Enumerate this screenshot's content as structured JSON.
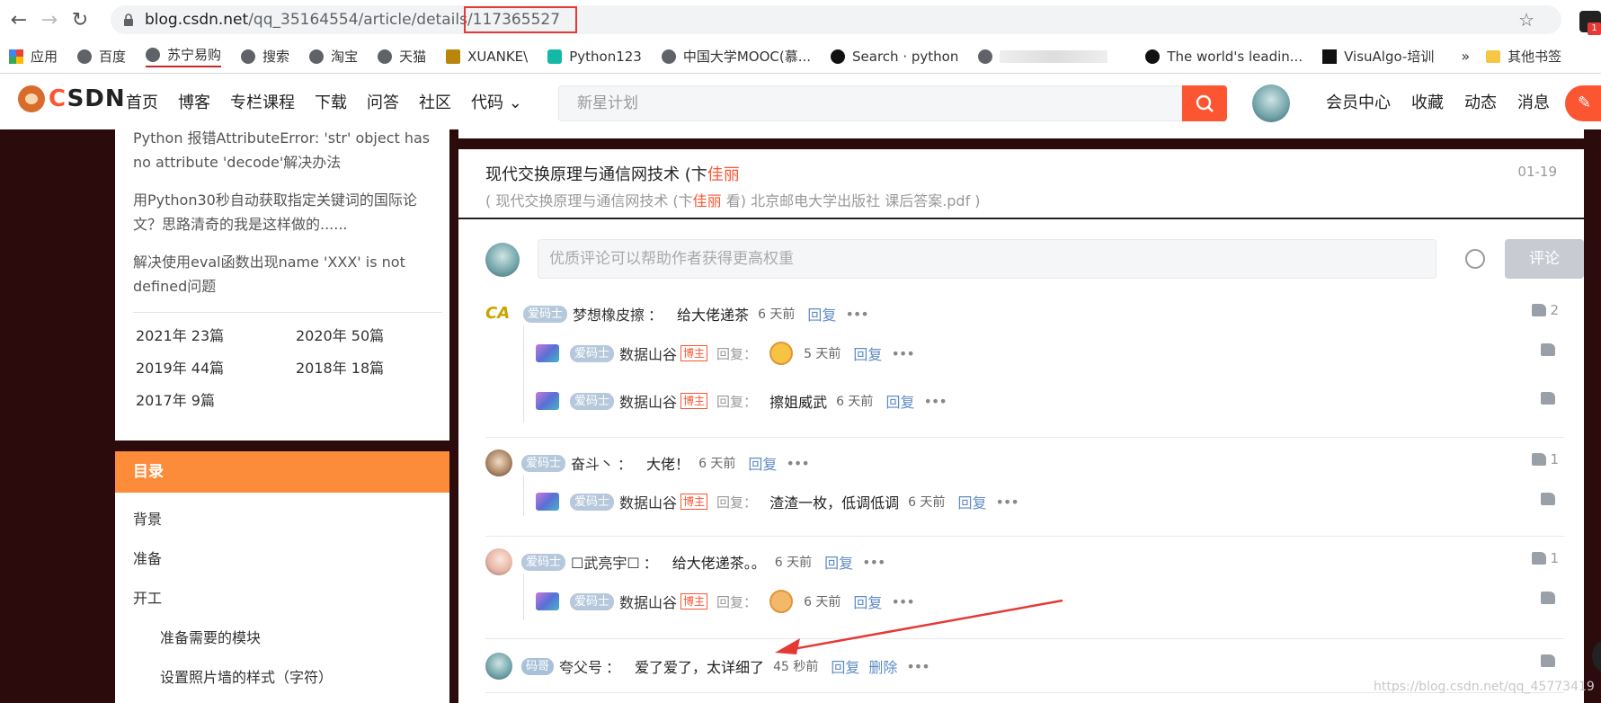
{
  "browser": {
    "url_host": "blog.csdn.net",
    "url_path": "/qq_35164554/article/details/",
    "url_id": "117365527",
    "ext_badge": "1",
    "bookmarks": [
      {
        "label": "应用",
        "icon": "grid"
      },
      {
        "label": "百度",
        "icon": "globe"
      },
      {
        "label": "苏宁易购",
        "icon": "globe",
        "active": true
      },
      {
        "label": "搜索",
        "icon": "globe"
      },
      {
        "label": "淘宝",
        "icon": "globe"
      },
      {
        "label": "天猫",
        "icon": "globe"
      },
      {
        "label": "XUANKE\\",
        "icon": "favicon"
      },
      {
        "label": "Python123",
        "icon": "py"
      },
      {
        "label": "中国大学MOOC(慕...",
        "icon": "globe"
      },
      {
        "label": "Search · python",
        "icon": "github"
      },
      {
        "label": "The world's leadin...",
        "icon": "github"
      },
      {
        "label": "VisuAlgo-培训",
        "icon": "va"
      }
    ],
    "bookmarks_more": "»",
    "other_bookmarks": "其他书签"
  },
  "csdn": {
    "logo": "CSDN",
    "nav": [
      "首页",
      "博客",
      "专栏课程",
      "下载",
      "问答",
      "社区",
      "代码 ⌄"
    ],
    "search_placeholder": "新星计划",
    "right_nav": [
      "会员中心",
      "收藏",
      "动态",
      "消息"
    ]
  },
  "sidebar": {
    "related": [
      "Python 报错AttributeError: 'str' object has no attribute 'decode'解决办法",
      "用Python30秒自动获取指定关键词的国际论文？思路清奇的我是这样做的......",
      "解决使用eval函数出现name 'XXX' is not defined问题"
    ],
    "archive": [
      "2021年  23篇",
      "2020年  50篇",
      "2019年  44篇",
      "2018年  18篇",
      "2017年  9篇"
    ],
    "toc_title": "目录",
    "toc": [
      {
        "label": "背景",
        "level": 1
      },
      {
        "label": "准备",
        "level": 1
      },
      {
        "label": "开工",
        "level": 1
      },
      {
        "label": "准备需要的模块",
        "level": 2
      },
      {
        "label": "设置照片墙的样式（字符）",
        "level": 2
      }
    ]
  },
  "recommend": {
    "title_a": "现代交换原理与通信网技术 (卞",
    "title_b": "佳丽",
    "desc_a": "( 现代交换原理与通信网技术 (卞",
    "desc_b": "佳丽",
    "desc_c": " 看) 北京邮电大学出版社 课后答案.pdf )",
    "date": "01-19"
  },
  "comment_form": {
    "placeholder": "优质评论可以帮助作者获得更高权重",
    "submit": "评论"
  },
  "comments": [
    {
      "name": "梦想橡皮擦",
      "badge": "爱码士",
      "colon": "：",
      "text": "给大佬递茶",
      "time": "6 天前",
      "reply": "回复",
      "likes": "2",
      "avatar": "ca"
    },
    {
      "name": "数据山谷",
      "badge": "爱码士",
      "author": "博主",
      "label": "回复：",
      "text": "",
      "emoji": true,
      "time": "5 天前",
      "reply": "回复",
      "likes": "",
      "is_reply": true
    },
    {
      "name": "数据山谷",
      "badge": "爱码士",
      "author": "博主",
      "label": "回复：",
      "text": "擦姐威武",
      "time": "6 天前",
      "reply": "回复",
      "likes": "",
      "is_reply": true
    },
    {
      "name": "奋斗丶",
      "badge": "爱码士",
      "colon": "：",
      "text": "大佬！",
      "time": "6 天前",
      "reply": "回复",
      "likes": "1",
      "avatar": "girl"
    },
    {
      "name": "数据山谷",
      "badge": "爱码士",
      "author": "博主",
      "label": "回复：",
      "text": "渣渣一枚，低调低调",
      "time": "6 天前",
      "reply": "回复",
      "likes": "",
      "is_reply": true
    },
    {
      "name": "☐武亮宇☐",
      "badge": "爱码士",
      "colon": "：",
      "text": "给大佬递茶。。",
      "time": "6 天前",
      "reply": "回复",
      "likes": "1",
      "avatar": "anime"
    },
    {
      "name": "数据山谷",
      "badge": "爱码士",
      "author": "博主",
      "label": "回复：",
      "text": "",
      "emoji": true,
      "time": "6 天前",
      "reply": "回复",
      "likes": "",
      "is_reply": true
    },
    {
      "name": "夸父号",
      "badge": "码哥",
      "colon": "：",
      "text": "爱了爱了，太详细了",
      "time": "45 秒前",
      "reply": "回复",
      "delete": "删除",
      "likes": "",
      "avatar": "me"
    }
  ],
  "more_dots": "•••",
  "watermark": "https://blog.csdn.net/qq_45773419",
  "colors": {
    "brand": "#fc5531",
    "toc_head": "#fc8c3a",
    "link": "#5f8cc5",
    "annotation_red": "#e53935"
  }
}
